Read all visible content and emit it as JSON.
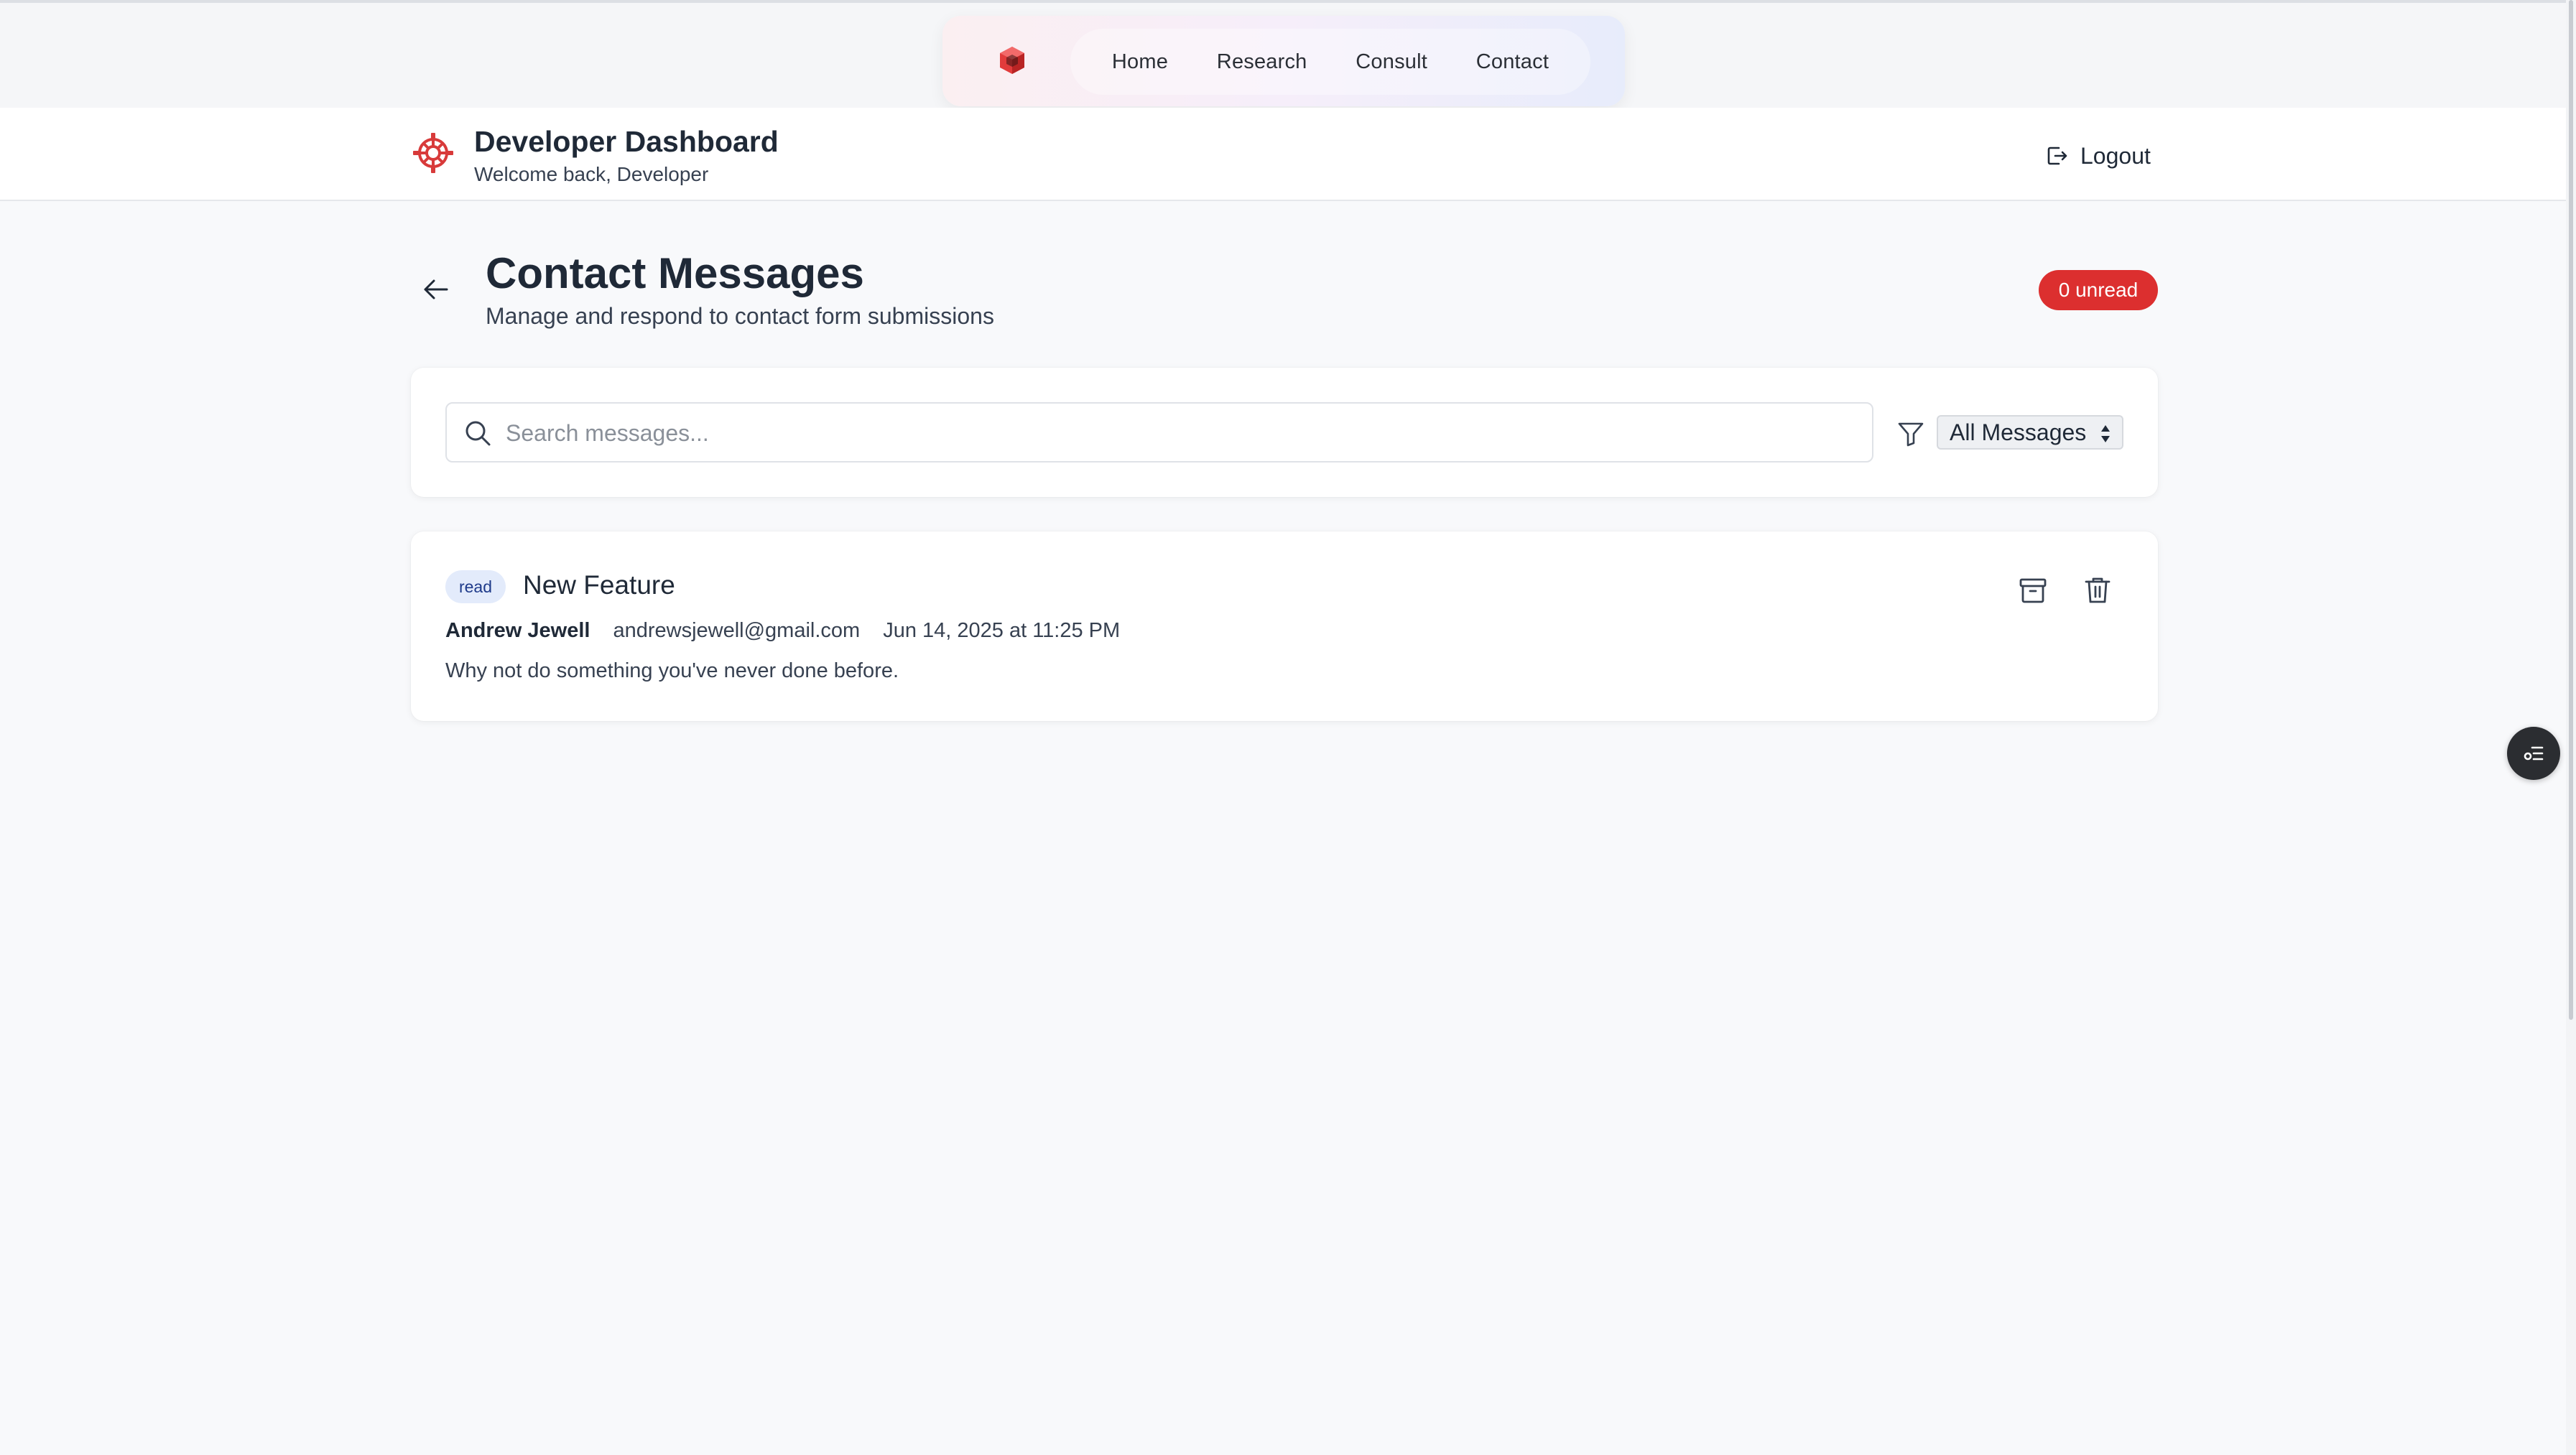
{
  "topnav": {
    "links": [
      "Home",
      "Research",
      "Consult",
      "Contact"
    ],
    "icon": "cube-icon"
  },
  "header": {
    "title": "Developer Dashboard",
    "subtitle": "Welcome back, Developer",
    "logout_label": "Logout",
    "icon": "gear-icon"
  },
  "page": {
    "title": "Contact Messages",
    "subtitle": "Manage and respond to contact form submissions",
    "unread_badge": "0 unread"
  },
  "filters": {
    "search_placeholder": "Search messages...",
    "search_value": "",
    "select_value": "All Messages"
  },
  "messages": [
    {
      "status": "read",
      "subject": "New Feature",
      "sender": "Andrew Jewell",
      "email": "andrewsjewell@gmail.com",
      "date": "Jun 14, 2025 at 11:25 PM",
      "body": "Why not do something you've never done before."
    }
  ],
  "colors": {
    "accent_red": "#dc2f2f",
    "read_badge_bg": "#e3ebfb",
    "page_bg": "#f8f9fb"
  }
}
